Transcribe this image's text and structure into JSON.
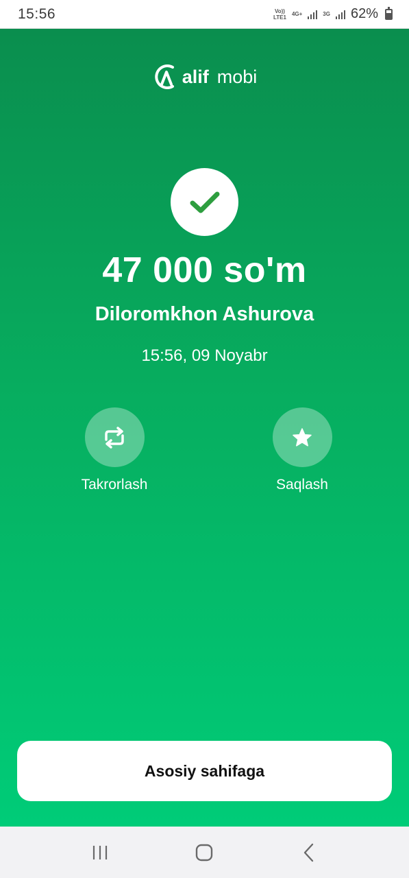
{
  "status_bar": {
    "time": "15:56",
    "volte_top": "Vo))",
    "volte_bottom": "LTE1",
    "net1": "4G+",
    "net2": "3G",
    "battery": "62%"
  },
  "brand": {
    "name_bold": "alif",
    "name_light": "mobi",
    "mark_icon": "alif-logo-icon"
  },
  "receipt": {
    "status_icon": "check-icon",
    "amount": "47 000 so'm",
    "recipient": "Diloromkhon Ashurova",
    "datetime": "15:56, 09 Noyabr"
  },
  "actions": {
    "repeat_label": "Takrorlash",
    "repeat_icon": "repeat-icon",
    "save_label": "Saqlash",
    "save_icon": "star-icon"
  },
  "home_button_label": "Asosiy sahifaga",
  "colors": {
    "gradient_top": "#0a8e4e",
    "gradient_bottom": "#00cc78",
    "check": "#2e9e3f"
  },
  "nav": {
    "recent_icon": "recent-apps-icon",
    "home_icon": "home-icon",
    "back_icon": "back-icon"
  }
}
